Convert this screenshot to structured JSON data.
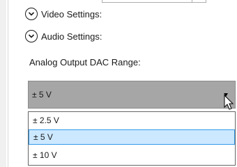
{
  "expanders": [
    {
      "label": "Video Settings:",
      "icon": "chevron-down-icon"
    },
    {
      "label": "Audio Settings:",
      "icon": "chevron-down-icon"
    }
  ],
  "dac_range": {
    "label": "Analog Output DAC Range:",
    "selected_value": "± 5 V",
    "options": [
      {
        "label": "± 2.5 V",
        "selected": false
      },
      {
        "label": "± 5 V",
        "selected": true
      },
      {
        "label": "± 10 V",
        "selected": false
      }
    ]
  },
  "colors": {
    "combo_background": "#a6a6a6",
    "selected_option_background": "#cce8ff",
    "selected_option_border": "#3399e8"
  }
}
